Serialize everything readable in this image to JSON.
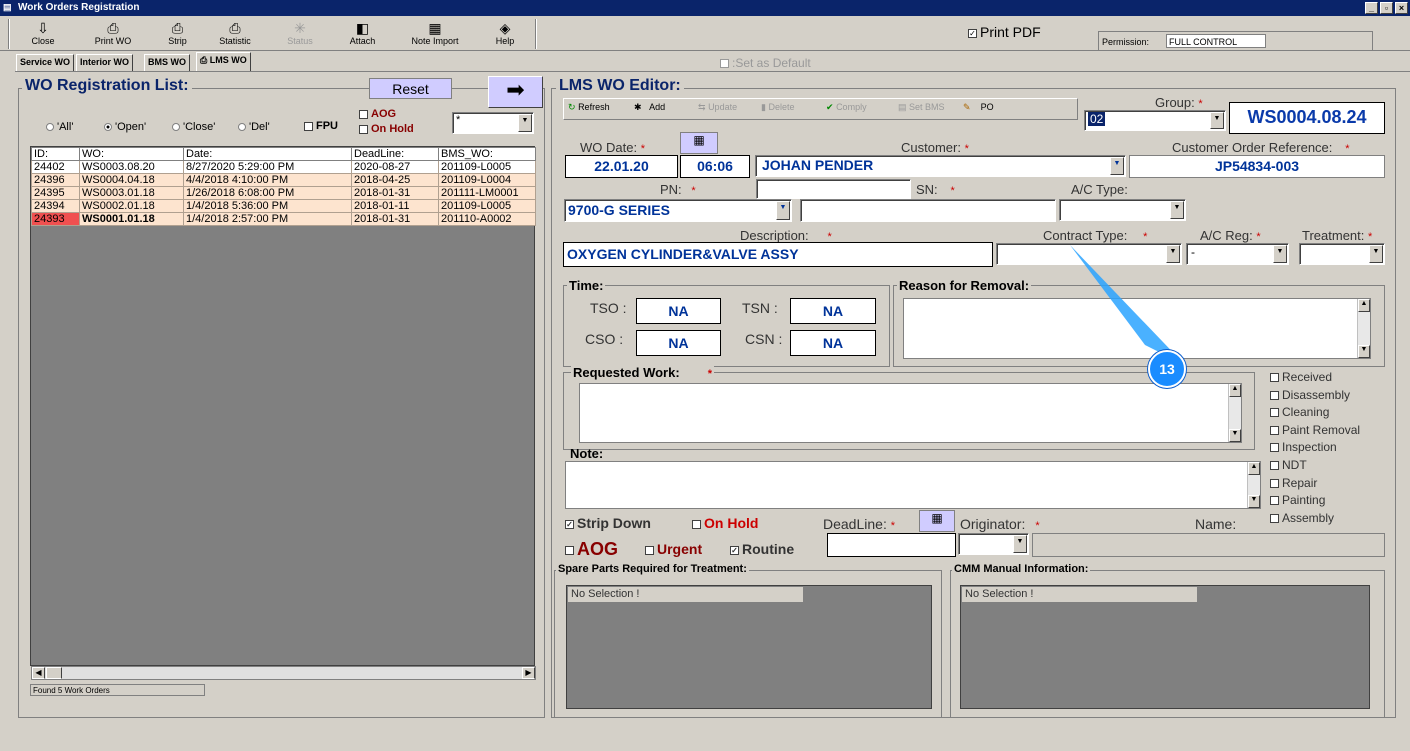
{
  "window": {
    "title": "Work Orders Registration"
  },
  "toolbar": {
    "items": [
      {
        "label": "Close",
        "icon": "close-icon"
      },
      {
        "label": "Print WO",
        "icon": "printer-icon"
      },
      {
        "label": "Strip",
        "icon": "printer-icon"
      },
      {
        "label": "Statistic",
        "icon": "printer-icon"
      },
      {
        "label": "Status",
        "icon": "asterisk-icon"
      },
      {
        "label": "Attach",
        "icon": "attach-icon"
      },
      {
        "label": "Note Import",
        "icon": "note-icon"
      },
      {
        "label": "Help",
        "icon": "help-icon"
      }
    ],
    "print_pdf": "Print PDF",
    "permission_label": "Permission:",
    "permission_value": "FULL CONTROL"
  },
  "set_default": ":Set as Default",
  "tabs": [
    "Service WO",
    "Interior WO",
    "BMS WO",
    "LMS WO"
  ],
  "registration": {
    "title": "WO Registration List:",
    "reset": "Reset",
    "filters": [
      "'All'",
      "'Open'",
      "'Close'",
      "'Del'"
    ],
    "fpu": "FPU",
    "aog": "AOG",
    "on_hold": "On Hold",
    "filter_value": "*",
    "columns": [
      "ID:",
      "WO:",
      "Date:",
      "DeadLine:",
      "BMS_WO:"
    ],
    "rows": [
      [
        "24402",
        "WS0003.08.20",
        "8/27/2020 5:29:00 PM",
        "2020-08-27",
        "201109-L0005"
      ],
      [
        "24396",
        "WS0004.04.18",
        "4/4/2018 4:10:00 PM",
        "2018-04-25",
        "201109-L0004"
      ],
      [
        "24395",
        "WS0003.01.18",
        "1/26/2018 6:08:00 PM",
        "2018-01-31",
        "201111-LM0001"
      ],
      [
        "24394",
        "WS0002.01.18",
        "1/4/2018 5:36:00 PM",
        "2018-01-11",
        "201109-L0005"
      ],
      [
        "24393",
        "WS0001.01.18",
        "1/4/2018 2:57:00 PM",
        "2018-01-31",
        "201110-A0002"
      ]
    ],
    "status": "Found 5 Work Orders"
  },
  "editor": {
    "title": "LMS WO Editor:",
    "tools": [
      "Refresh",
      "Add",
      "Update",
      "Delete",
      "Comply",
      "Set BMS",
      "PO"
    ],
    "group_label": "Group:",
    "group_value": "02",
    "wo_number": "WS0004.08.24",
    "wo_date_label": "WO Date:",
    "wo_date": "22.01.20",
    "wo_time": "06:06",
    "customer_label": "Customer:",
    "customer": "JOHAN PENDER",
    "cust_ref_label": "Customer Order Reference:",
    "cust_ref": "JP54834-003",
    "pn_label": "PN:",
    "pn": "9700-G SERIES",
    "sn_label": "SN:",
    "ac_type_label": "A/C Type:",
    "description_label": "Description:",
    "description": "OXYGEN CYLINDER&VALVE ASSY",
    "contract_label": "Contract Type:",
    "ac_reg_label": "A/C Reg:",
    "ac_reg": "-",
    "treatment_label": "Treatment:",
    "time_label": "Time:",
    "tso_label": "TSO :",
    "tso": "NA",
    "tsn_label": "TSN :",
    "tsn": "NA",
    "cso_label": "CSO :",
    "cso": "NA",
    "csn_label": "CSN :",
    "csn": "NA",
    "reason_label": "Reason for Removal:",
    "requested_label": "Requested Work:",
    "note_label": "Note:",
    "checklist": [
      "Received",
      "Disassembly",
      "Cleaning",
      "Paint Removal",
      "Inspection",
      "NDT",
      "Repair",
      "Painting",
      "Assembly"
    ],
    "strip_down": "Strip Down",
    "on_hold": "On Hold",
    "deadline_label": "DeadLine:",
    "originator_label": "Originator:",
    "name_label": "Name:",
    "aog": "AOG",
    "urgent": "Urgent",
    "routine": "Routine",
    "spare_label": "Spare Parts Required for Treatment:",
    "spare_sel": "No Selection !",
    "cmm_label": "CMM Manual Information:",
    "cmm_sel": "No Selection !",
    "callout": "13"
  }
}
